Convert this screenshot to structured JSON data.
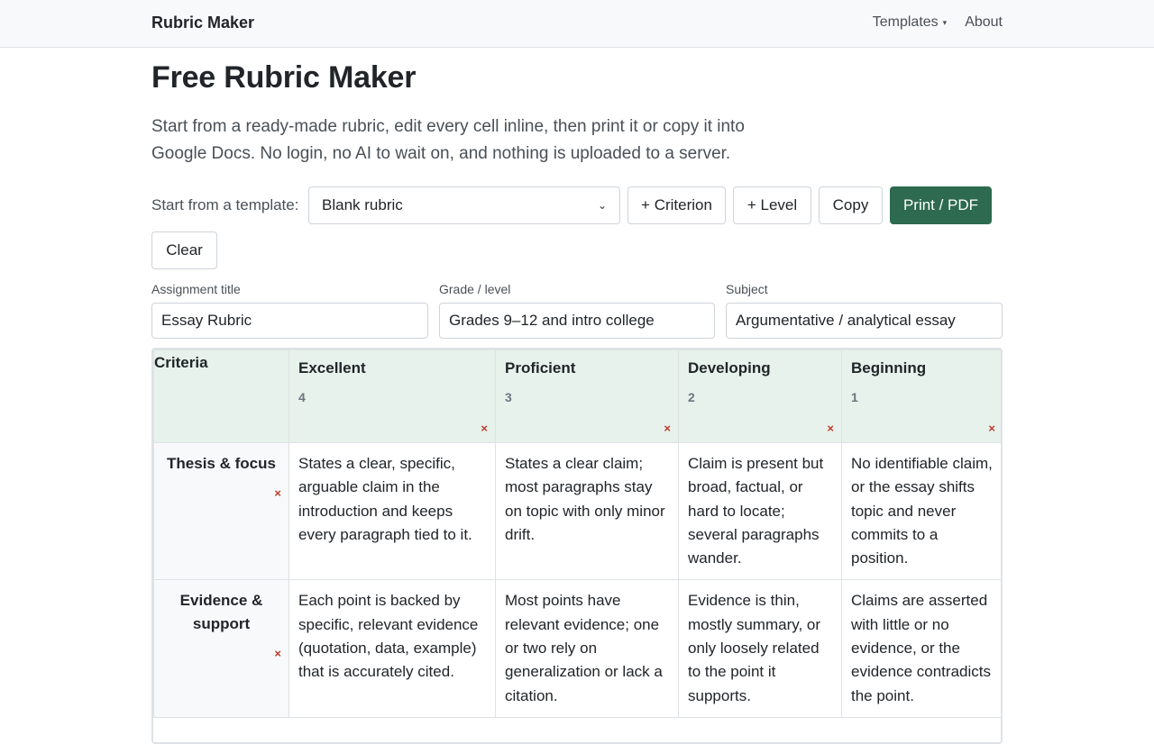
{
  "nav": {
    "brand": "Rubric Maker",
    "templates": "Templates",
    "about": "About"
  },
  "page": {
    "title": "Free Rubric Maker",
    "lead": "Start from a ready-made rubric, edit every cell inline, then print it or copy it into Google Docs. No login, no AI to wait on, and nothing is uploaded to a server."
  },
  "toolbar": {
    "template_label": "Start from a template:",
    "template_selected": "Blank rubric",
    "add_criterion": "+ Criterion",
    "add_level": "+ Level",
    "copy": "Copy",
    "print": "Print / PDF",
    "clear": "Clear"
  },
  "fields": {
    "title_label": "Assignment title",
    "title_value": "Essay Rubric",
    "grade_label": "Grade / level",
    "grade_value": "Grades 9–12 and intro college",
    "subject_label": "Subject",
    "subject_value": "Argumentative / analytical essay"
  },
  "rubric": {
    "criteria_header": "Criteria",
    "delete_symbol": "×",
    "levels": [
      {
        "name": "Excellent",
        "points": "4"
      },
      {
        "name": "Proficient",
        "points": "3"
      },
      {
        "name": "Developing",
        "points": "2"
      },
      {
        "name": "Beginning",
        "points": "1"
      }
    ],
    "rows": [
      {
        "criterion": "Thesis & focus",
        "cells": [
          "States a clear, specific, arguable claim in the introduction and keeps every paragraph tied to it.",
          "States a clear claim; most paragraphs stay on topic with only minor drift.",
          "Claim is present but broad, factual, or hard to locate; several paragraphs wander.",
          "No identifiable claim, or the essay shifts topic and never commits to a position."
        ]
      },
      {
        "criterion": "Evidence & support",
        "cells": [
          "Each point is backed by specific, relevant evidence (quotation, data, example) that is accurately cited.",
          "Most points have relevant evidence; one or two rely on generalization or lack a citation.",
          "Evidence is thin, mostly summary, or only loosely related to the point it supports.",
          "Claims are asserted with little or no evidence, or the evidence contradicts the point."
        ]
      }
    ]
  },
  "colors": {
    "primary": "#2d6a4f",
    "header_bg": "#e8f2ec",
    "delete": "#c0392b"
  }
}
